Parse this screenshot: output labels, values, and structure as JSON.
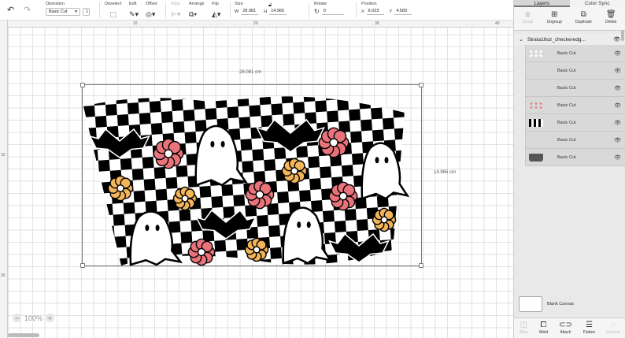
{
  "toolbar": {
    "operation_label": "Operation",
    "operation_value": "Basic Cut",
    "operation_count": "1",
    "deselect_label": "Deselect",
    "edit_label": "Edit",
    "offset_label": "Offset",
    "align_label": "Align",
    "arrange_label": "Arrange",
    "flip_label": "Flip",
    "size_label": "Size",
    "size_w_label": "W",
    "size_w": "28.081",
    "size_h_label": "H",
    "size_h": "14.965",
    "rotate_label": "Rotate",
    "rotate_value": "0",
    "position_label": "Position",
    "pos_x_label": "X",
    "pos_x": "6.023",
    "pos_y_label": "Y",
    "pos_y": "4.583"
  },
  "ruler": {
    "top": [
      "10",
      "20",
      "30",
      "40"
    ],
    "left": [
      "10",
      "20"
    ]
  },
  "canvas": {
    "width_label": "28.081 cm",
    "height_label": "14.965 cm",
    "zoom": "100%"
  },
  "panel": {
    "tabs": [
      "Layers",
      "Color Sync"
    ],
    "tools": [
      "Group",
      "Ungroup",
      "Duplicate",
      "Delete"
    ],
    "group_name": "Strata16oz_checkeredg...",
    "layers": [
      {
        "name": "Basic Cut"
      },
      {
        "name": "Basic Cut"
      },
      {
        "name": "Basic Cut"
      },
      {
        "name": "Basic Cut"
      },
      {
        "name": "Basic Cut"
      },
      {
        "name": "Basic Cut"
      },
      {
        "name": "Basic Cut"
      }
    ],
    "blank_canvas": "Blank Canvas",
    "bottom_tools": [
      "Slice",
      "Weld",
      "Attach",
      "Flatten",
      "Contour"
    ]
  },
  "colors": {
    "accent": "#777777",
    "flower_pink": "#e8737a",
    "flower_yellow": "#f3b55a",
    "ink": "#000000"
  }
}
